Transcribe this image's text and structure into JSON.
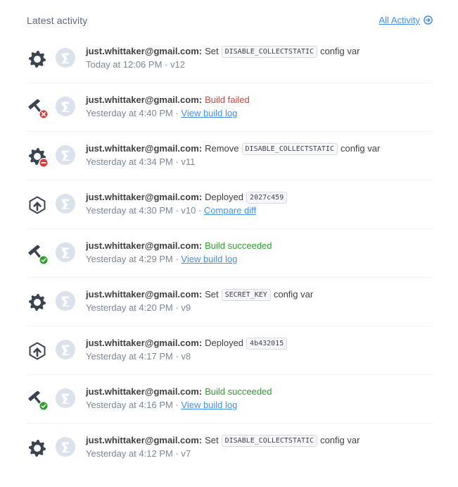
{
  "header": {
    "title": "Latest activity",
    "all_activity_label": "All Activity"
  },
  "colors": {
    "link": "#408fec",
    "failed": "#d93b3b",
    "success": "#2b9e2b",
    "icon": "#3a4451",
    "avatar_bg": "#dbe2ec"
  },
  "activities": [
    {
      "icon": "gear-icon",
      "user": "just.whittaker@gmail.com:",
      "action": "Set",
      "code": "DISABLE_COLLECTSTATIC",
      "suffix": "config var",
      "status": "",
      "time": "Today at 12:06 PM",
      "meta": "v12",
      "link": ""
    },
    {
      "icon": "hammer-failed-icon",
      "user": "just.whittaker@gmail.com:",
      "action": "",
      "code": "",
      "suffix": "",
      "status": "Build failed",
      "time": "Yesterday at 4:40 PM",
      "meta": "",
      "link": "View build log"
    },
    {
      "icon": "gear-removed-icon",
      "user": "just.whittaker@gmail.com:",
      "action": "Remove",
      "code": "DISABLE_COLLECTSTATIC",
      "suffix": "config var",
      "status": "",
      "time": "Yesterday at 4:34 PM",
      "meta": "v11",
      "link": ""
    },
    {
      "icon": "deploy-icon",
      "user": "just.whittaker@gmail.com:",
      "action": "Deployed",
      "code": "2027c459",
      "suffix": "",
      "status": "",
      "time": "Yesterday at 4:30 PM",
      "meta": "v10",
      "link": "Compare diff"
    },
    {
      "icon": "hammer-success-icon",
      "user": "just.whittaker@gmail.com:",
      "action": "",
      "code": "",
      "suffix": "",
      "status": "Build succeeded",
      "time": "Yesterday at 4:29 PM",
      "meta": "",
      "link": "View build log"
    },
    {
      "icon": "gear-icon",
      "user": "just.whittaker@gmail.com:",
      "action": "Set",
      "code": "SECRET_KEY",
      "suffix": "config var",
      "status": "",
      "time": "Yesterday at 4:20 PM",
      "meta": "v9",
      "link": ""
    },
    {
      "icon": "deploy-icon",
      "user": "just.whittaker@gmail.com:",
      "action": "Deployed",
      "code": "4b432015",
      "suffix": "",
      "status": "",
      "time": "Yesterday at 4:17 PM",
      "meta": "v8",
      "link": ""
    },
    {
      "icon": "hammer-success-icon",
      "user": "just.whittaker@gmail.com:",
      "action": "",
      "code": "",
      "suffix": "",
      "status": "Build succeeded",
      "time": "Yesterday at 4:16 PM",
      "meta": "",
      "link": "View build log"
    },
    {
      "icon": "gear-icon",
      "user": "just.whittaker@gmail.com:",
      "action": "Set",
      "code": "DISABLE_COLLECTSTATIC",
      "suffix": "config var",
      "status": "",
      "time": "Yesterday at 4:12 PM",
      "meta": "v7",
      "link": ""
    }
  ]
}
